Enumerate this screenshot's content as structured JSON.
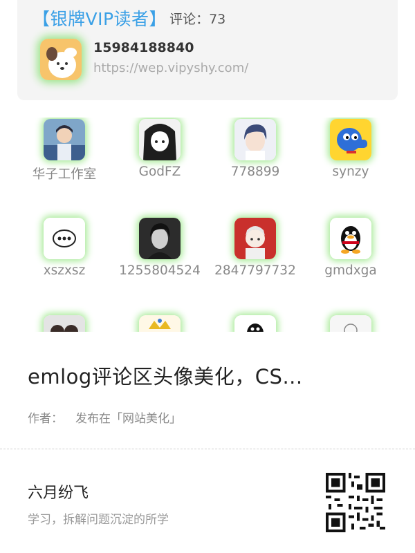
{
  "reader": {
    "rank": "【银牌VIP读者】",
    "comment_label": "评论：73",
    "name": "15984188840",
    "url": "https://wep.vipyshy.com/"
  },
  "avatars": [
    {
      "name": "华子工作室",
      "icon": "boy-illustration-avatar"
    },
    {
      "name": "GodFZ",
      "icon": "manga-girl-avatar"
    },
    {
      "name": "778899",
      "icon": "anime-boy-avatar"
    },
    {
      "name": "synzy",
      "icon": "blue-dog-avatar"
    },
    {
      "name": "xszxsz",
      "icon": "chat-bubble-avatar"
    },
    {
      "name": "1255804524",
      "icon": "dark-boy-avatar"
    },
    {
      "name": "2847797732",
      "icon": "chibi-character-avatar"
    },
    {
      "name": "gmdxga",
      "icon": "qq-penguin-avatar"
    },
    {
      "name": "",
      "icon": "photo-avatar"
    },
    {
      "name": "",
      "icon": "crown-avatar"
    },
    {
      "name": "",
      "icon": "qq-penguin-avatar"
    },
    {
      "name": "",
      "icon": "sketch-avatar"
    }
  ],
  "share": {
    "title": "emlog评论区头像美化，CS...",
    "author_label": "作者：",
    "category": "发布在「网站美化」",
    "site_name": "六月纷飞",
    "slogan": "学习，拆解问题沉淀的所学"
  },
  "colors": {
    "accent": "#3aa0e6",
    "glow": "#9be58a"
  }
}
